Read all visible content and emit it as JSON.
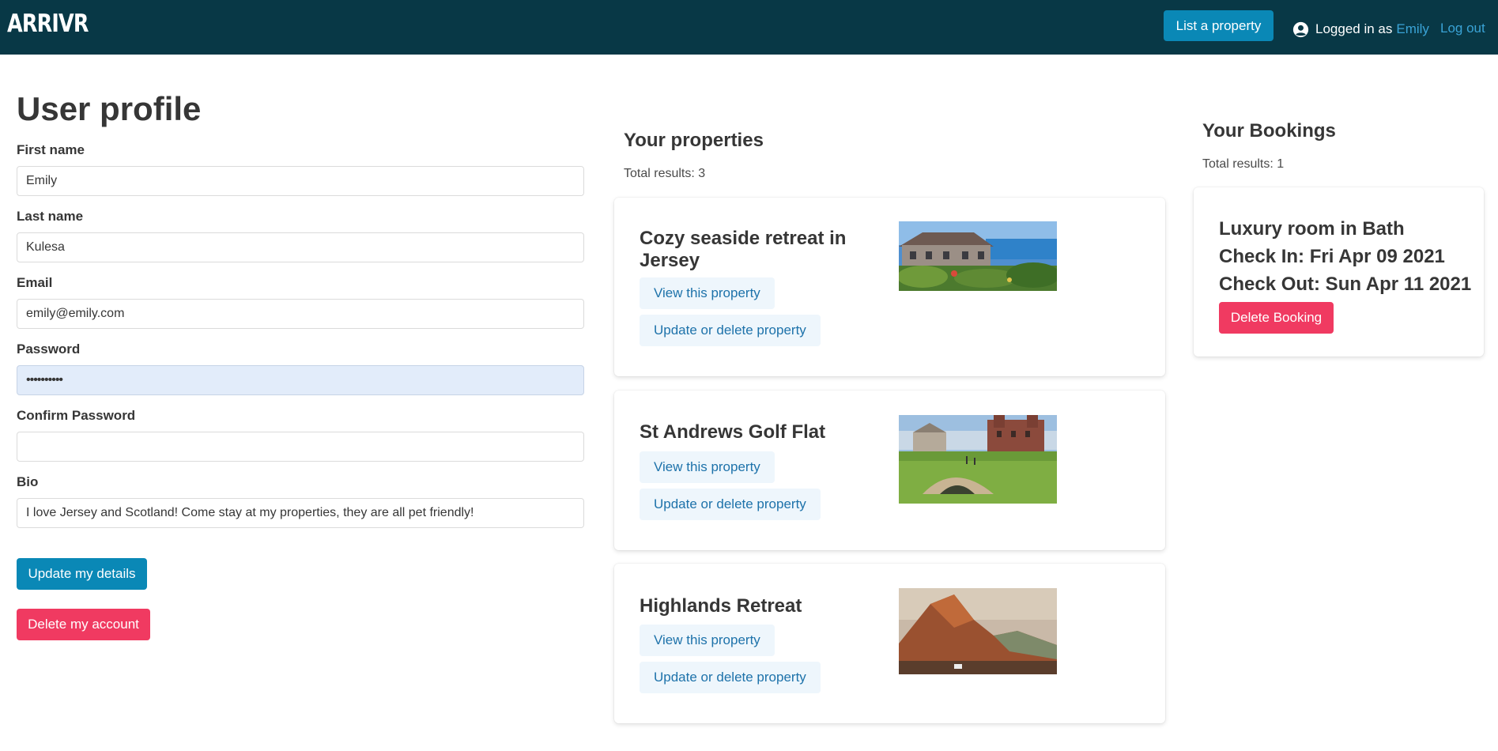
{
  "navbar": {
    "logo": "ARRIVR",
    "list_property_label": "List a property",
    "logged_in_prefix": "Logged in as",
    "username": "Emily",
    "logout_label": "Log out",
    "user_icon": "user-circle-icon"
  },
  "profile": {
    "title": "User profile",
    "fields": {
      "first_name": {
        "label": "First name",
        "value": "Emily"
      },
      "last_name": {
        "label": "Last name",
        "value": "Kulesa"
      },
      "email": {
        "label": "Email",
        "value": "emily@emily.com"
      },
      "password": {
        "label": "Password",
        "value": "••••••••••"
      },
      "confirm_password": {
        "label": "Confirm Password",
        "value": ""
      },
      "bio": {
        "label": "Bio",
        "value": "I love Jersey and Scotland! Come stay at my properties, they are all pet friendly!"
      }
    },
    "update_label": "Update my details",
    "delete_label": "Delete my account"
  },
  "properties": {
    "title": "Your properties",
    "total": "Total results: 3",
    "items": [
      {
        "name": "Cozy seaside retreat in Jersey",
        "view_label": "View this property",
        "edit_label": "Update or delete property"
      },
      {
        "name": "St Andrews Golf Flat",
        "view_label": "View this property",
        "edit_label": "Update or delete property"
      },
      {
        "name": "Highlands Retreat",
        "view_label": "View this property",
        "edit_label": "Update or delete property"
      }
    ]
  },
  "bookings": {
    "title": "Your Bookings",
    "total": "Total results: 1",
    "items": [
      {
        "name": "Luxury room in Bath",
        "check_in": "Check In: Fri Apr 09 2021",
        "check_out": "Check Out: Sun Apr 11 2021",
        "delete_label": "Delete Booking"
      }
    ]
  },
  "colors": {
    "navbar": "#083846",
    "primary": "#0a88b6",
    "danger": "#f03a61",
    "link": "#3aa3d6",
    "light_button": "#eef6fc"
  }
}
